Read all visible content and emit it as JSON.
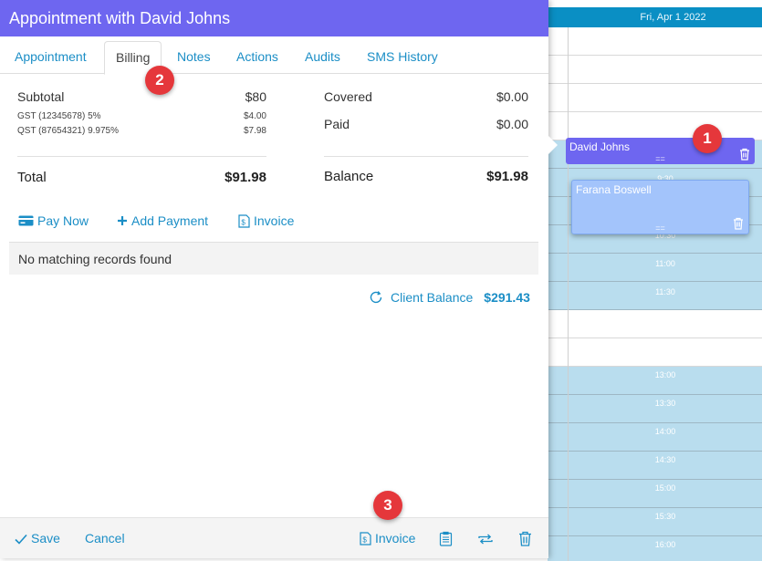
{
  "calendar": {
    "date_header": "Fri, Apr 1 2022",
    "time_labels": [
      "9:30",
      "10:30",
      "11:00",
      "11:30",
      "13:00",
      "13:30",
      "14:00",
      "14:30",
      "15:00",
      "15:30",
      "16:00"
    ],
    "appointments": {
      "first": {
        "name": "David Johns",
        "grip": "=="
      },
      "second": {
        "name": "Farana Boswell",
        "grip": "=="
      }
    }
  },
  "badges": [
    "1",
    "2",
    "3"
  ],
  "modal": {
    "title": "Appointment with David Johns",
    "tabs": [
      "Appointment",
      "Billing",
      "Notes",
      "Actions",
      "Audits",
      "SMS History"
    ],
    "active_tab": "Billing",
    "billing": {
      "subtotal_label": "Subtotal",
      "subtotal_value": "$80",
      "tax1_label": "GST (12345678) 5%",
      "tax1_value": "$4.00",
      "tax2_label": "QST (87654321) 9.975%",
      "tax2_value": "$7.98",
      "total_label": "Total",
      "total_value": "$91.98",
      "covered_label": "Covered",
      "covered_value": "$0.00",
      "paid_label": "Paid",
      "paid_value": "$0.00",
      "balance_label": "Balance",
      "balance_value": "$91.98"
    },
    "actions": {
      "pay_now": "Pay Now",
      "add_payment": "Add Payment",
      "invoice": "Invoice"
    },
    "empty_message": "No matching records found",
    "client_balance_label": "Client Balance",
    "client_balance_value": "$291.43",
    "footer": {
      "save": "Save",
      "cancel": "Cancel",
      "invoice": "Invoice"
    }
  },
  "colors": {
    "header_purple": "#6e66f0",
    "link_blue": "#1b8ec6",
    "calendar_blue": "#0a8fc4",
    "slot_blue": "#b9ddee",
    "badge_red": "#e5373b"
  },
  "icons": {
    "pay_now": "credit-card-icon",
    "add_payment": "plus-icon",
    "invoice": "invoice-icon",
    "client_balance": "refresh-icon",
    "save": "check-icon",
    "notes": "clipboard-icon",
    "repeat": "repeat-icon",
    "delete": "trash-icon"
  }
}
